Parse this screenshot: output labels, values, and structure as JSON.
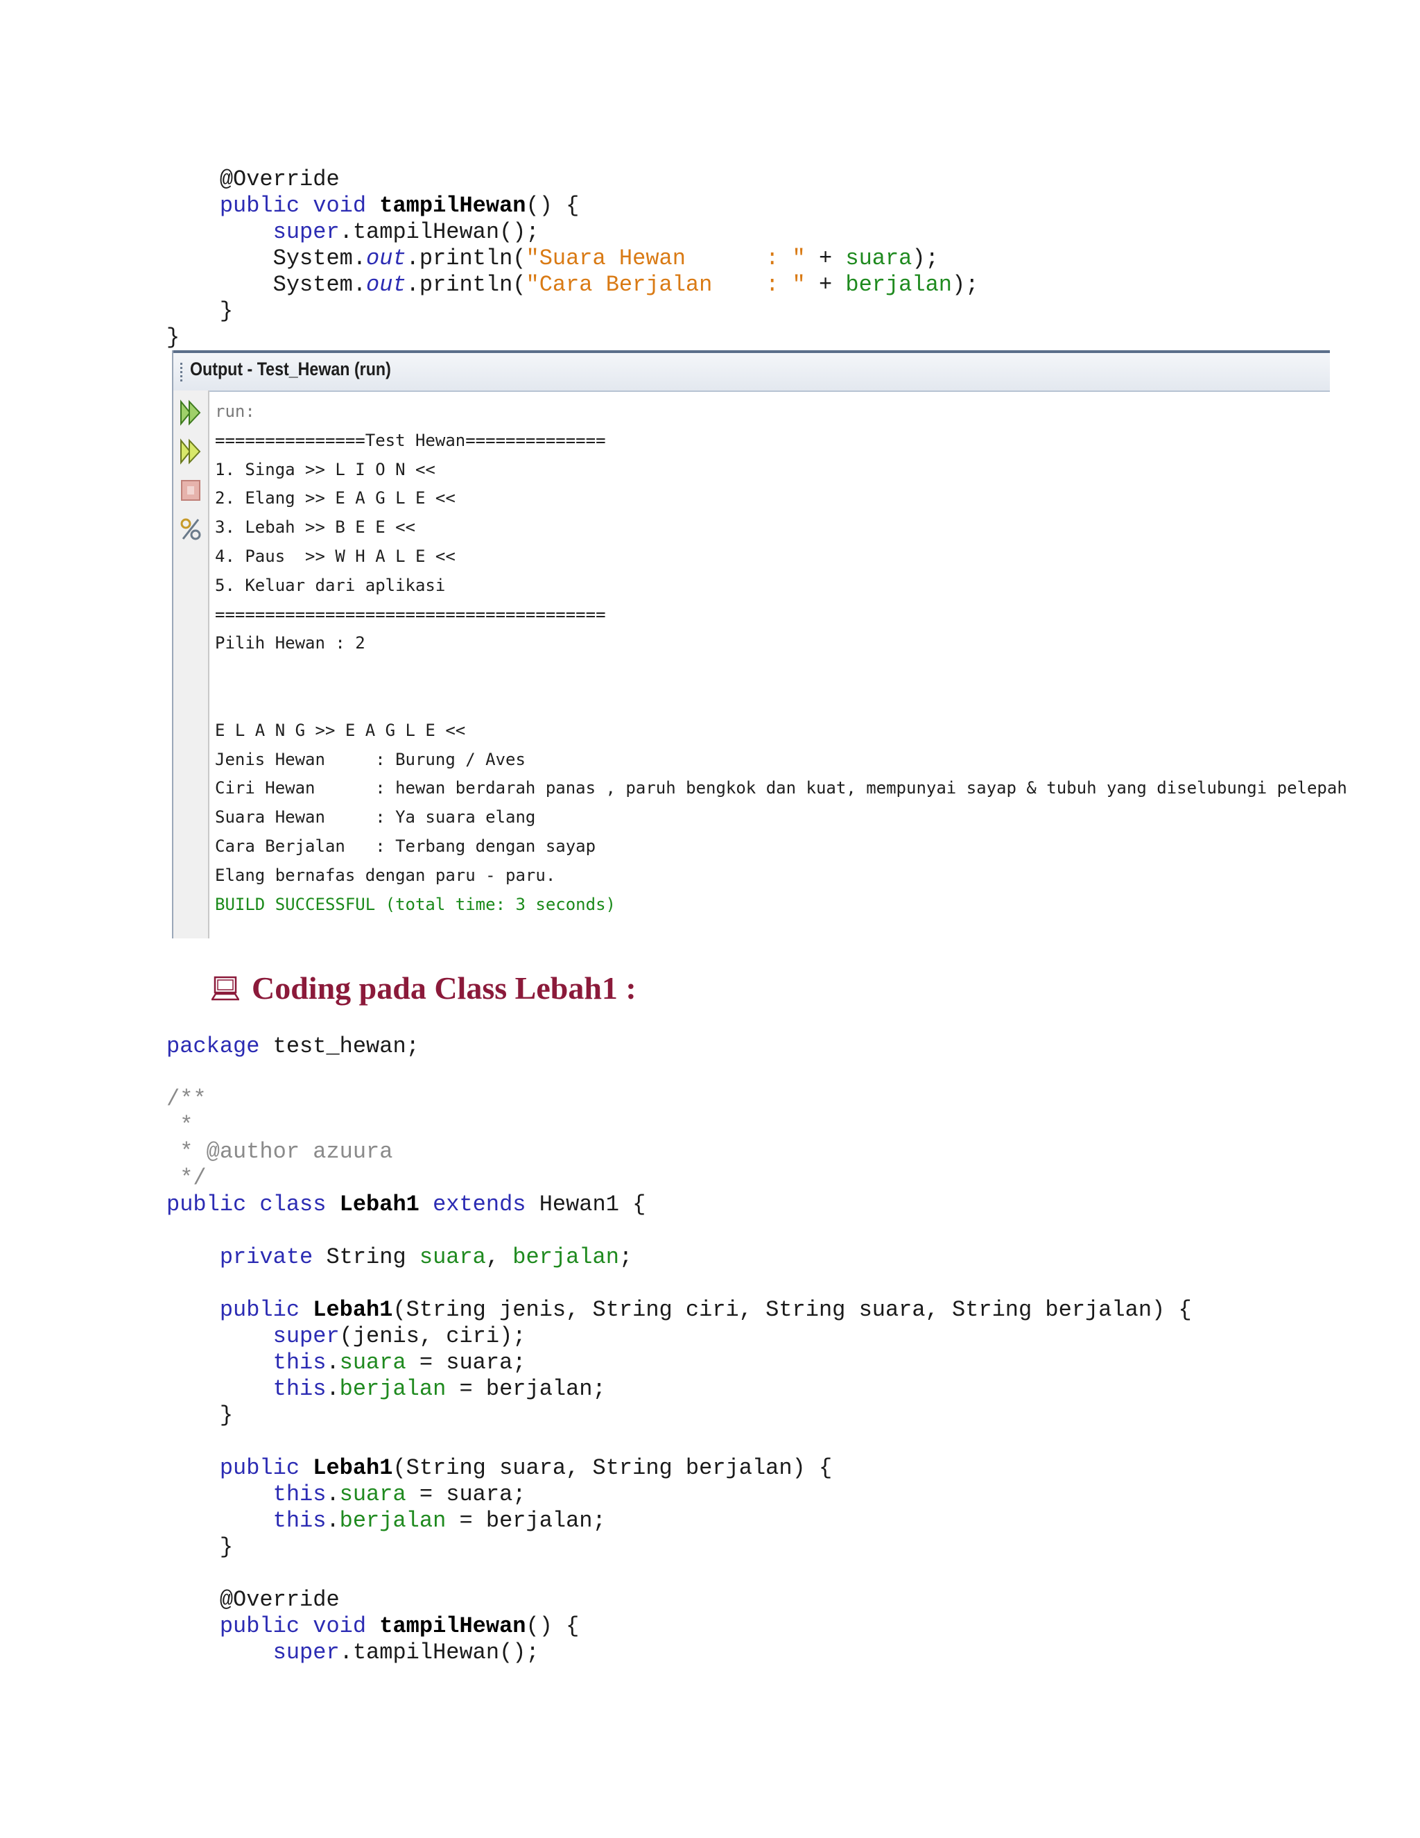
{
  "code_top": [
    {
      "indent": 4,
      "parts": [
        [
          "ann",
          "@Override"
        ]
      ]
    },
    {
      "indent": 4,
      "parts": [
        [
          "kw",
          "public void "
        ],
        [
          "b",
          "tampilHewan"
        ],
        [
          "",
          "() {"
        ]
      ]
    },
    {
      "indent": 8,
      "parts": [
        [
          "kw",
          "super"
        ],
        [
          "",
          ".tampilHewan();"
        ]
      ]
    },
    {
      "indent": 8,
      "parts": [
        [
          "",
          "System."
        ],
        [
          "ital",
          "out"
        ],
        [
          "",
          ".println("
        ],
        [
          "str",
          "\"Suara Hewan      : \""
        ],
        [
          "",
          " + "
        ],
        [
          "fld",
          "suara"
        ],
        [
          "",
          ");"
        ]
      ]
    },
    {
      "indent": 8,
      "parts": [
        [
          "",
          "System."
        ],
        [
          "ital",
          "out"
        ],
        [
          "",
          ".println("
        ],
        [
          "str",
          "\"Cara Berjalan    : \""
        ],
        [
          "",
          " + "
        ],
        [
          "fld",
          "berjalan"
        ],
        [
          "",
          ");"
        ]
      ]
    },
    {
      "indent": 4,
      "parts": [
        [
          "",
          "}"
        ]
      ]
    },
    {
      "indent": 0,
      "parts": [
        [
          "",
          "}"
        ]
      ]
    }
  ],
  "output_panel": {
    "title": "Output - Test_Hewan (run)",
    "gutter_icons": [
      "rerun-icon",
      "rerun-debug-icon",
      "stop-icon",
      "settings-icon"
    ],
    "lines": [
      {
        "cls": "dim",
        "text": "run:"
      },
      {
        "cls": "",
        "text": "===============Test Hewan=============="
      },
      {
        "cls": "",
        "text": "1. Singa >> L I O N <<"
      },
      {
        "cls": "",
        "text": "2. Elang >> E A G L E <<"
      },
      {
        "cls": "",
        "text": "3. Lebah >> B E E <<"
      },
      {
        "cls": "",
        "text": "4. Paus  >> W H A L E <<"
      },
      {
        "cls": "",
        "text": "5. Keluar dari aplikasi"
      },
      {
        "cls": "",
        "text": "======================================="
      },
      {
        "cls": "",
        "text": "Pilih Hewan : 2"
      },
      {
        "cls": "",
        "text": ""
      },
      {
        "cls": "",
        "text": ""
      },
      {
        "cls": "",
        "text": "E L A N G >> E A G L E <<"
      },
      {
        "cls": "",
        "text": "Jenis Hewan     : Burung / Aves"
      },
      {
        "cls": "",
        "text": "Ciri Hewan      : hewan berdarah panas , paruh bengkok dan kuat, mempunyai sayap & tubuh yang diselubungi pelepah"
      },
      {
        "cls": "",
        "text": "Suara Hewan     : Ya suara elang"
      },
      {
        "cls": "",
        "text": "Cara Berjalan   : Terbang dengan sayap"
      },
      {
        "cls": "",
        "text": "Elang bernafas dengan paru - paru."
      },
      {
        "cls": "ok",
        "text": "BUILD SUCCESSFUL (total time: 3 seconds)"
      }
    ]
  },
  "section_heading": {
    "text": "Coding pada Class Lebah1 :",
    "icon": "computer-icon"
  },
  "code_bottom": [
    {
      "indent": 0,
      "parts": [
        [
          "kw",
          "package"
        ],
        [
          "",
          " test_hewan;"
        ]
      ]
    },
    {
      "indent": 0,
      "parts": []
    },
    {
      "indent": 0,
      "parts": [
        [
          "cm",
          "/**"
        ]
      ]
    },
    {
      "indent": 0,
      "parts": [
        [
          "cm",
          " *"
        ]
      ]
    },
    {
      "indent": 0,
      "parts": [
        [
          "cm",
          " * @author azuura"
        ]
      ]
    },
    {
      "indent": 0,
      "parts": [
        [
          "cm",
          " */"
        ]
      ]
    },
    {
      "indent": 0,
      "parts": [
        [
          "kw",
          "public class "
        ],
        [
          "b",
          "Lebah1"
        ],
        [
          "kw",
          " extends"
        ],
        [
          "",
          " Hewan1 {"
        ]
      ]
    },
    {
      "indent": 0,
      "parts": []
    },
    {
      "indent": 4,
      "parts": [
        [
          "kw",
          "private"
        ],
        [
          "",
          " String "
        ],
        [
          "fld",
          "suara"
        ],
        [
          "",
          ", "
        ],
        [
          "fld",
          "berjalan"
        ],
        [
          "",
          ";"
        ]
      ]
    },
    {
      "indent": 0,
      "parts": []
    },
    {
      "indent": 4,
      "parts": [
        [
          "kw",
          "public "
        ],
        [
          "b",
          "Lebah1"
        ],
        [
          "",
          "(String jenis, String ciri, String suara, String berjalan) {"
        ]
      ]
    },
    {
      "indent": 8,
      "parts": [
        [
          "kw",
          "super"
        ],
        [
          "",
          "(jenis, ciri);"
        ]
      ]
    },
    {
      "indent": 8,
      "parts": [
        [
          "kw",
          "this"
        ],
        [
          "",
          "."
        ],
        [
          "fld",
          "suara"
        ],
        [
          "",
          " = suara;"
        ]
      ]
    },
    {
      "indent": 8,
      "parts": [
        [
          "kw",
          "this"
        ],
        [
          "",
          "."
        ],
        [
          "fld",
          "berjalan"
        ],
        [
          "",
          " = berjalan;"
        ]
      ]
    },
    {
      "indent": 4,
      "parts": [
        [
          "",
          "}"
        ]
      ]
    },
    {
      "indent": 0,
      "parts": []
    },
    {
      "indent": 4,
      "parts": [
        [
          "kw",
          "public "
        ],
        [
          "b",
          "Lebah1"
        ],
        [
          "",
          "(String suara, String berjalan) {"
        ]
      ]
    },
    {
      "indent": 8,
      "parts": [
        [
          "kw",
          "this"
        ],
        [
          "",
          "."
        ],
        [
          "fld",
          "suara"
        ],
        [
          "",
          " = suara;"
        ]
      ]
    },
    {
      "indent": 8,
      "parts": [
        [
          "kw",
          "this"
        ],
        [
          "",
          "."
        ],
        [
          "fld",
          "berjalan"
        ],
        [
          "",
          " = berjalan;"
        ]
      ]
    },
    {
      "indent": 4,
      "parts": [
        [
          "",
          "}"
        ]
      ]
    },
    {
      "indent": 0,
      "parts": []
    },
    {
      "indent": 4,
      "parts": [
        [
          "ann",
          "@Override"
        ]
      ]
    },
    {
      "indent": 4,
      "parts": [
        [
          "kw",
          "public void "
        ],
        [
          "b",
          "tampilHewan"
        ],
        [
          "",
          "() {"
        ]
      ]
    },
    {
      "indent": 8,
      "parts": [
        [
          "kw",
          "super"
        ],
        [
          "",
          ".tampilHewan();"
        ]
      ]
    }
  ]
}
